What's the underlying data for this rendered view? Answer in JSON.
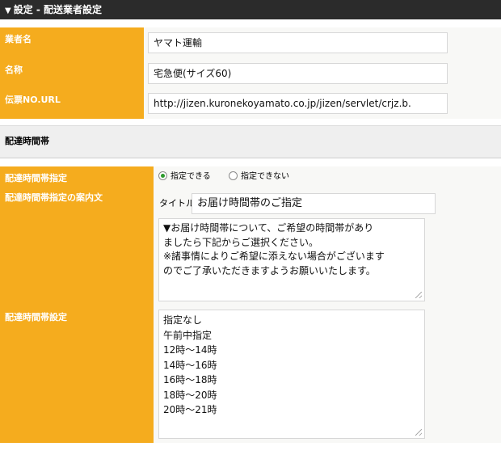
{
  "header": {
    "title": "設定 - 配送業者設定"
  },
  "fields": {
    "carrier": {
      "label": "業者名",
      "value": "ヤマト運輸"
    },
    "name": {
      "label": "名称",
      "value": "宅急便(サイズ60)"
    },
    "tracking_url": {
      "label": "伝票NO.URL",
      "value": "http://jizen.kuronekoyamato.co.jp/jizen/servlet/crjz.b."
    }
  },
  "delivery_section": {
    "title": "配達時間帯",
    "designation": {
      "label": "配達時間帯指定",
      "options": [
        "指定できる",
        "指定できない"
      ],
      "selected": "指定できる"
    },
    "guide": {
      "label": "配達時間帯指定の案内文",
      "title_label": "タイトル",
      "title_value": "お届け時間帯のご指定",
      "lines": [
        "▼お届け時間帯について、ご希望の時間帯があり",
        "ましたら下記からご選択ください。",
        "※諸事情によりご希望に添えない場合がございます",
        "のでご了承いただきますようお願いいたします。"
      ]
    },
    "slots": {
      "label": "配達時間帯設定",
      "items": [
        "指定なし",
        "午前中指定",
        "12時～14時",
        "14時～16時",
        "16時～18時",
        "18時～20時",
        "20時～21時"
      ]
    }
  }
}
